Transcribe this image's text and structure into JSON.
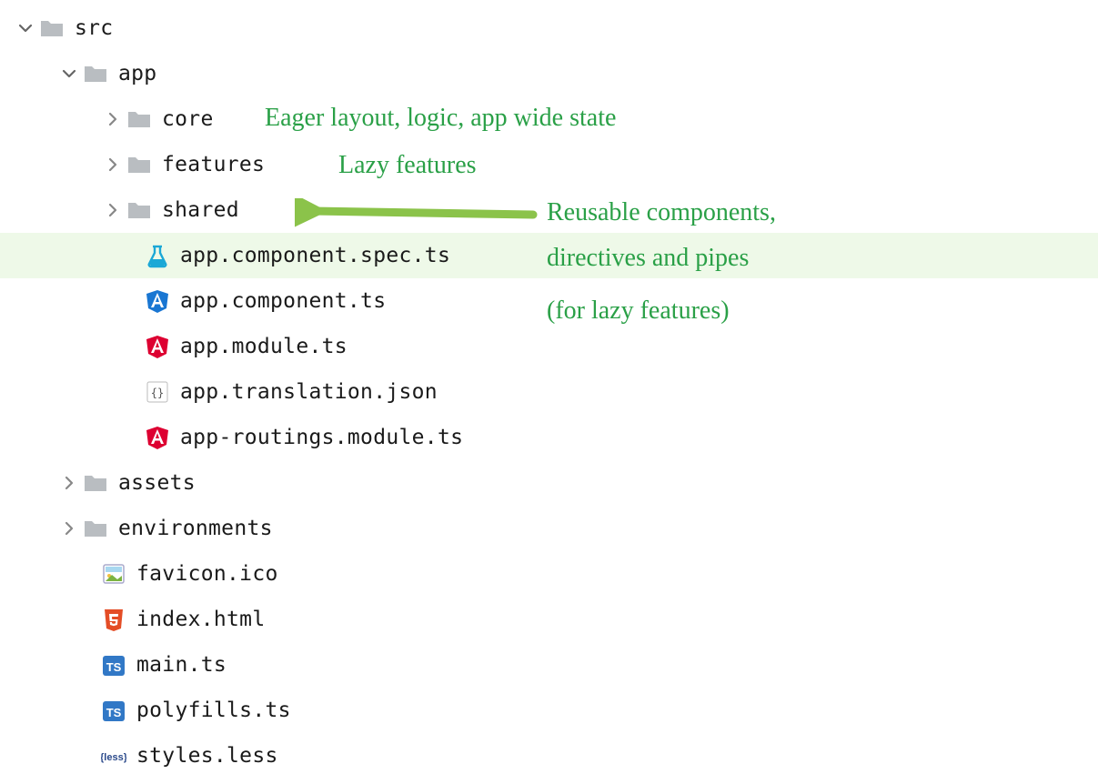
{
  "tree": {
    "src": "src",
    "app": "app",
    "core": "core",
    "features": "features",
    "shared": "shared",
    "appComponentSpec": "app.component.spec.ts",
    "appComponent": "app.component.ts",
    "appModule": "app.module.ts",
    "appTranslation": "app.translation.json",
    "appRouting": "app-routings.module.ts",
    "assets": "assets",
    "environments": "environments",
    "favicon": "favicon.ico",
    "indexHtml": "index.html",
    "mainTs": "main.ts",
    "polyfills": "polyfills.ts",
    "styles": "styles.less"
  },
  "annotations": {
    "coreNote": "Eager layout, logic, app wide state",
    "featuresNote": "Lazy features",
    "sharedNote1": "Reusable components,",
    "sharedNote2": "directives and pipes",
    "sharedNote3": "(for lazy features)"
  },
  "colors": {
    "annotationText": "#2aa047",
    "arrow": "#8bc34a",
    "highlight": "#eef9e8",
    "folder": "#b9bdc1",
    "angularRed": "#dd0031",
    "angularBlue": "#1976d2",
    "html5": "#e44d26",
    "ts": "#3178c6"
  }
}
